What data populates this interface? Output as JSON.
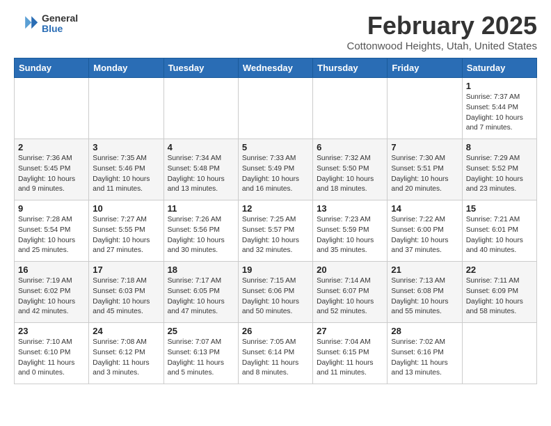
{
  "header": {
    "logo_general": "General",
    "logo_blue": "Blue",
    "title": "February 2025",
    "location": "Cottonwood Heights, Utah, United States"
  },
  "weekdays": [
    "Sunday",
    "Monday",
    "Tuesday",
    "Wednesday",
    "Thursday",
    "Friday",
    "Saturday"
  ],
  "weeks": [
    [
      {
        "day": "",
        "info": ""
      },
      {
        "day": "",
        "info": ""
      },
      {
        "day": "",
        "info": ""
      },
      {
        "day": "",
        "info": ""
      },
      {
        "day": "",
        "info": ""
      },
      {
        "day": "",
        "info": ""
      },
      {
        "day": "1",
        "info": "Sunrise: 7:37 AM\nSunset: 5:44 PM\nDaylight: 10 hours and 7 minutes."
      }
    ],
    [
      {
        "day": "2",
        "info": "Sunrise: 7:36 AM\nSunset: 5:45 PM\nDaylight: 10 hours and 9 minutes."
      },
      {
        "day": "3",
        "info": "Sunrise: 7:35 AM\nSunset: 5:46 PM\nDaylight: 10 hours and 11 minutes."
      },
      {
        "day": "4",
        "info": "Sunrise: 7:34 AM\nSunset: 5:48 PM\nDaylight: 10 hours and 13 minutes."
      },
      {
        "day": "5",
        "info": "Sunrise: 7:33 AM\nSunset: 5:49 PM\nDaylight: 10 hours and 16 minutes."
      },
      {
        "day": "6",
        "info": "Sunrise: 7:32 AM\nSunset: 5:50 PM\nDaylight: 10 hours and 18 minutes."
      },
      {
        "day": "7",
        "info": "Sunrise: 7:30 AM\nSunset: 5:51 PM\nDaylight: 10 hours and 20 minutes."
      },
      {
        "day": "8",
        "info": "Sunrise: 7:29 AM\nSunset: 5:52 PM\nDaylight: 10 hours and 23 minutes."
      }
    ],
    [
      {
        "day": "9",
        "info": "Sunrise: 7:28 AM\nSunset: 5:54 PM\nDaylight: 10 hours and 25 minutes."
      },
      {
        "day": "10",
        "info": "Sunrise: 7:27 AM\nSunset: 5:55 PM\nDaylight: 10 hours and 27 minutes."
      },
      {
        "day": "11",
        "info": "Sunrise: 7:26 AM\nSunset: 5:56 PM\nDaylight: 10 hours and 30 minutes."
      },
      {
        "day": "12",
        "info": "Sunrise: 7:25 AM\nSunset: 5:57 PM\nDaylight: 10 hours and 32 minutes."
      },
      {
        "day": "13",
        "info": "Sunrise: 7:23 AM\nSunset: 5:59 PM\nDaylight: 10 hours and 35 minutes."
      },
      {
        "day": "14",
        "info": "Sunrise: 7:22 AM\nSunset: 6:00 PM\nDaylight: 10 hours and 37 minutes."
      },
      {
        "day": "15",
        "info": "Sunrise: 7:21 AM\nSunset: 6:01 PM\nDaylight: 10 hours and 40 minutes."
      }
    ],
    [
      {
        "day": "16",
        "info": "Sunrise: 7:19 AM\nSunset: 6:02 PM\nDaylight: 10 hours and 42 minutes."
      },
      {
        "day": "17",
        "info": "Sunrise: 7:18 AM\nSunset: 6:03 PM\nDaylight: 10 hours and 45 minutes."
      },
      {
        "day": "18",
        "info": "Sunrise: 7:17 AM\nSunset: 6:05 PM\nDaylight: 10 hours and 47 minutes."
      },
      {
        "day": "19",
        "info": "Sunrise: 7:15 AM\nSunset: 6:06 PM\nDaylight: 10 hours and 50 minutes."
      },
      {
        "day": "20",
        "info": "Sunrise: 7:14 AM\nSunset: 6:07 PM\nDaylight: 10 hours and 52 minutes."
      },
      {
        "day": "21",
        "info": "Sunrise: 7:13 AM\nSunset: 6:08 PM\nDaylight: 10 hours and 55 minutes."
      },
      {
        "day": "22",
        "info": "Sunrise: 7:11 AM\nSunset: 6:09 PM\nDaylight: 10 hours and 58 minutes."
      }
    ],
    [
      {
        "day": "23",
        "info": "Sunrise: 7:10 AM\nSunset: 6:10 PM\nDaylight: 11 hours and 0 minutes."
      },
      {
        "day": "24",
        "info": "Sunrise: 7:08 AM\nSunset: 6:12 PM\nDaylight: 11 hours and 3 minutes."
      },
      {
        "day": "25",
        "info": "Sunrise: 7:07 AM\nSunset: 6:13 PM\nDaylight: 11 hours and 5 minutes."
      },
      {
        "day": "26",
        "info": "Sunrise: 7:05 AM\nSunset: 6:14 PM\nDaylight: 11 hours and 8 minutes."
      },
      {
        "day": "27",
        "info": "Sunrise: 7:04 AM\nSunset: 6:15 PM\nDaylight: 11 hours and 11 minutes."
      },
      {
        "day": "28",
        "info": "Sunrise: 7:02 AM\nSunset: 6:16 PM\nDaylight: 11 hours and 13 minutes."
      },
      {
        "day": "",
        "info": ""
      }
    ]
  ]
}
